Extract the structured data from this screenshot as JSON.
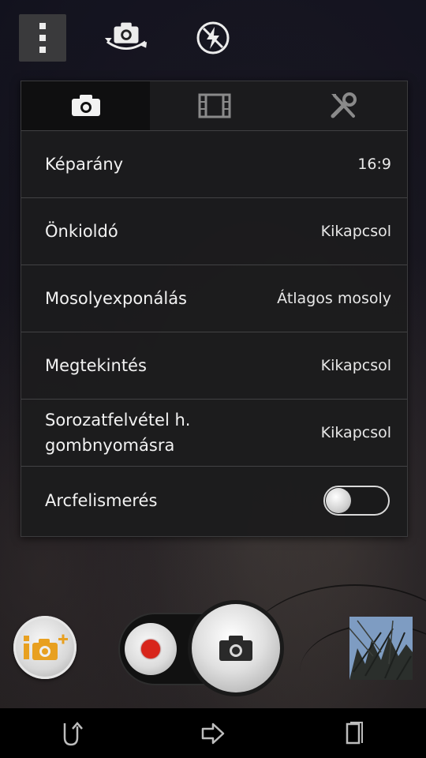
{
  "top_bar": {
    "icons": [
      "menu-icon",
      "switch-camera-icon",
      "flash-off-icon"
    ]
  },
  "settings": {
    "tabs": [
      {
        "icon": "camera-icon",
        "active": true
      },
      {
        "icon": "video-icon",
        "active": false
      },
      {
        "icon": "tools-icon",
        "active": false
      }
    ],
    "rows": [
      {
        "label": "Képarány",
        "value": "16:9"
      },
      {
        "label": "Önkioldó",
        "value": "Kikapcsol"
      },
      {
        "label": "Mosolyexponálás",
        "value": "Átlagos mosoly"
      },
      {
        "label": "Megtekintés",
        "value": "Kikapcsol"
      },
      {
        "label": "Sorozatfelvétel h. gombnyomásra",
        "value": "Kikapcsol"
      },
      {
        "label": "Arcfelismerés",
        "toggle_on": false
      }
    ]
  },
  "bottom": {
    "add_app_icon": "add-camera-app-icon",
    "record_color": "#d8251b",
    "capture_icon": "camera-icon",
    "thumbnail": "last-photo-thumbnail"
  },
  "navbar": {
    "icons": [
      "back-icon",
      "home-icon",
      "recent-apps-icon"
    ]
  }
}
